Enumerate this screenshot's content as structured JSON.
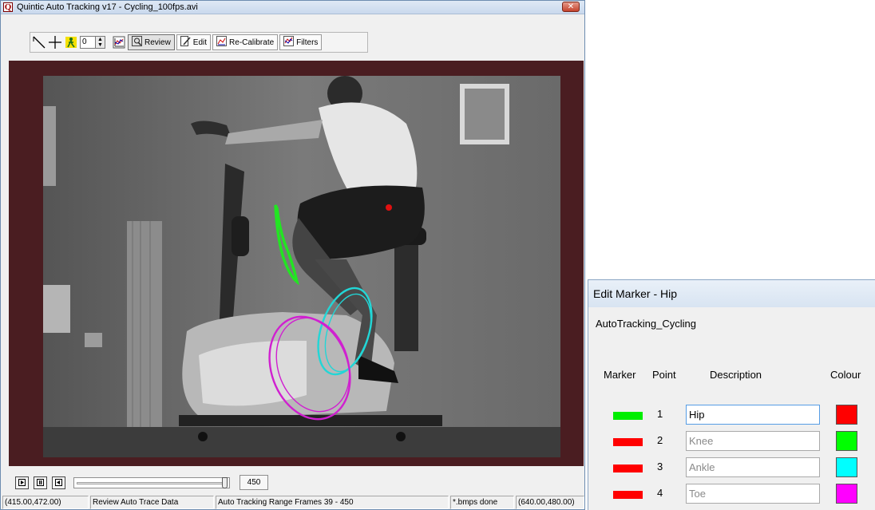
{
  "main_window": {
    "title": "Quintic Auto Tracking v17 - Cycling_100fps.avi",
    "icon_letter": "Q",
    "close_glyph": "✕",
    "toolbar": {
      "spin_value": "0",
      "review_label": "Review",
      "edit_label": "Edit",
      "recalibrate_label": "Re-Calibrate",
      "filters_label": "Filters"
    },
    "frame_value": "450",
    "status": {
      "coords": "(415.00,472.00)",
      "mode": "Review Auto Trace Data",
      "range": "Auto Tracking Range Frames 39 - 450",
      "bmps": "*.bmps done",
      "resolution": "(640.00,480.00)"
    }
  },
  "colors": {
    "video_border": "#4a1d21",
    "trace_green": "#22e522",
    "trace_cyan": "#22d6d6",
    "trace_magenta": "#d020d0",
    "marker_red": "#ff0000"
  },
  "dialog": {
    "title": "Edit Marker - Hip",
    "subtitle": "AutoTracking_Cycling",
    "headers": {
      "marker": "Marker",
      "point": "Point",
      "description": "Description",
      "colour": "Colour"
    },
    "markers": [
      {
        "point": "1",
        "description": "Hip",
        "marker_color": "#00ee00",
        "colour": "#ff0000"
      },
      {
        "point": "2",
        "description": "Knee",
        "marker_color": "#ff0000",
        "colour": "#00ff00"
      },
      {
        "point": "3",
        "description": "Ankle",
        "marker_color": "#ff0000",
        "colour": "#00ffff"
      },
      {
        "point": "4",
        "description": "Toe",
        "marker_color": "#ff0000",
        "colour": "#ff00ff"
      }
    ]
  }
}
